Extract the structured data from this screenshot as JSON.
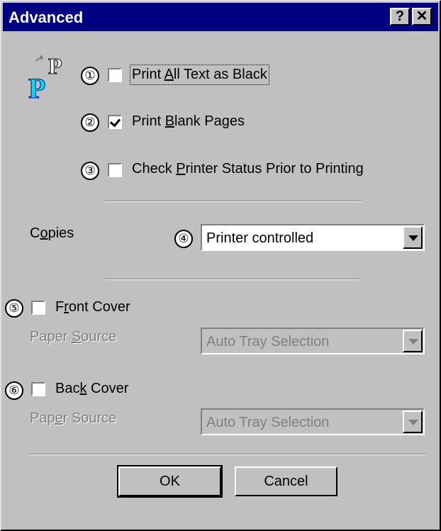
{
  "window": {
    "title": "Advanced",
    "help_label": "?",
    "close_label": "✕"
  },
  "options": [
    {
      "num": "①",
      "pre": "Print ",
      "key": "A",
      "post": "ll Text as Black",
      "checked": false
    },
    {
      "num": "②",
      "pre": "Print ",
      "key": "B",
      "post": "lank Pages",
      "checked": true
    },
    {
      "num": "③",
      "pre": "Check ",
      "key": "P",
      "post": "rinter Status Prior to Printing",
      "checked": false
    }
  ],
  "copies": {
    "pre": "C",
    "key": "o",
    "post": "pies",
    "num": "④",
    "value": "Printer controlled"
  },
  "front_cover": {
    "num": "⑤",
    "pre": "F",
    "key": "r",
    "post": "ont Cover",
    "checked": false,
    "source_pre": "Paper ",
    "source_key": "S",
    "source_post": "ource",
    "source_value": "Auto Tray Selection"
  },
  "back_cover": {
    "num": "⑥",
    "pre": "Bac",
    "key": "k",
    "post": " Cover",
    "checked": false,
    "source_pre": "Pap",
    "source_key": "e",
    "source_post": "r Source",
    "source_value": "Auto Tray Selection"
  },
  "buttons": {
    "ok": "OK",
    "cancel": "Cancel"
  },
  "icons": {
    "logo": "print-black-text-icon"
  }
}
